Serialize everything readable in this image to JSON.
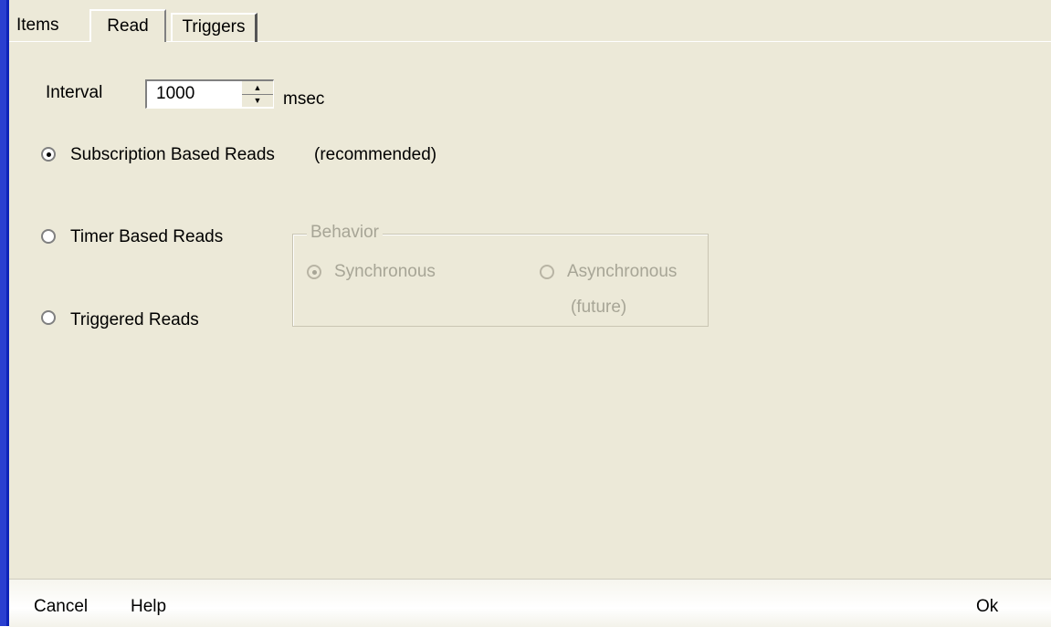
{
  "tabs": {
    "items": "Items",
    "read": "Read",
    "triggers": "Triggers",
    "active": "Read"
  },
  "interval": {
    "label": "Interval",
    "value": "1000",
    "unit": "msec"
  },
  "read_modes": {
    "subscription": "Subscription Based Reads",
    "recommended": "(recommended)",
    "timer": "Timer Based Reads",
    "triggered": "Triggered Reads",
    "selected": "Subscription Based Reads"
  },
  "behavior": {
    "title": "Behavior",
    "synchronous": "Synchronous",
    "asynchronous": "Asynchronous",
    "future": "(future)",
    "selected": "Synchronous",
    "enabled": false
  },
  "bottom_bar": {
    "cancel": "Cancel",
    "help": "Help",
    "ok": "Ok"
  },
  "colors": {
    "panel": "#ece9d8",
    "left_edge": "#2a3fd0",
    "disabled_text": "#a7a596"
  }
}
